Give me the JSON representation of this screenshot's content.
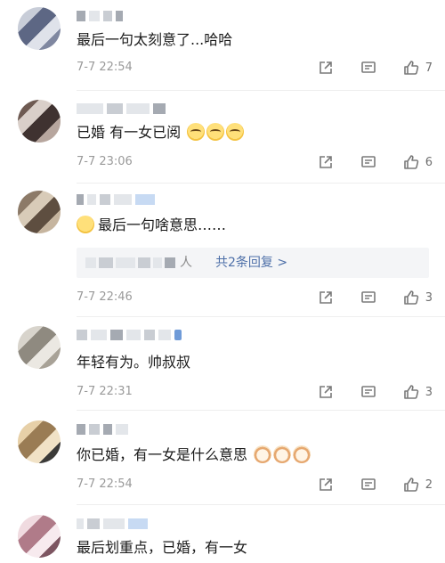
{
  "comments": [
    {
      "text": "最后一句太刻意了...哈哈",
      "time": "7-7 22:54",
      "likes": "7",
      "avatar_icon": "user-avatar-pixelated"
    },
    {
      "text": "已婚 有一女已阅",
      "time": "7-7 23:06",
      "likes": "6",
      "emoji_icons": [
        "crying-emoji-icon",
        "crying-emoji-icon",
        "crying-emoji-icon"
      ]
    },
    {
      "text": "最后一句啥意思……",
      "time": "7-7 22:46",
      "likes": "3",
      "reply_who": "人",
      "reply_link": "共2条回复 >",
      "emoji_icons": [
        "laughing-emoji-icon"
      ]
    },
    {
      "text": "年轻有为。帅叔叔",
      "time": "7-7 22:31",
      "likes": "3"
    },
    {
      "text": "你已婚，有一女是什么意思",
      "time": "7-7 22:54",
      "likes": "2",
      "emoji_icons": [
        "cat-emoji-icon",
        "cat-emoji-icon",
        "cat-emoji-icon"
      ]
    },
    {
      "text": "最后划重点，已婚，有一女"
    }
  ],
  "colors": {
    "meta_text": "#9a9a9a",
    "reply_link": "#4d6fa8",
    "reply_bg": "#f4f5f7"
  }
}
